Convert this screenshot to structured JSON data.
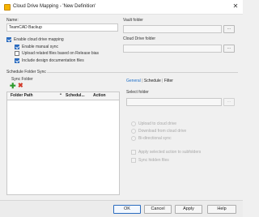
{
  "window": {
    "title": "Cloud Drive Mapping - 'New Definition'",
    "close_glyph": "✕"
  },
  "left": {
    "name_label": "Name:",
    "name_value": "TeamCAD Backup",
    "enable_cloud_mapping": {
      "label": "Enable cloud drive mapping",
      "checked": true
    },
    "enable_manual_sync": {
      "label": "Enable manual sync",
      "checked": true
    },
    "upload_release_bias": {
      "label": "Upload related files based on Release bias",
      "checked": false
    },
    "include_design_docs": {
      "label": "Include design documentation files",
      "checked": true
    }
  },
  "right": {
    "vault_folder_label": "Vault folder",
    "cloud_folder_label": "Cloud Drive folder",
    "browse_label": "..."
  },
  "schedule_sync": {
    "group_label": "Schedule Folder Sync",
    "sync_folder_label": "Sync Folder",
    "add_icon_glyph": "✚",
    "delete_icon_glyph": "✖",
    "columns": [
      "Folder Path",
      "Schedul...",
      "Action"
    ]
  },
  "detail_tabs": {
    "tabs": [
      "General",
      "Schedule",
      "Filter"
    ],
    "separator": "|",
    "active": "General",
    "select_folder_label": "Select folder",
    "browse_label": "...",
    "radios": [
      "Upload to cloud drive",
      "Download from cloud drive",
      "Bi-directional sync"
    ],
    "checkboxes": [
      "Apply selected action to subfolders",
      "Sync hidden files"
    ]
  },
  "footer": {
    "ok": "OK",
    "cancel": "Cancel",
    "apply": "Apply",
    "help": "Help"
  },
  "colors": {
    "accent": "#2a6bbf",
    "tab_active": "#1e6fc8",
    "add_icon": "#2e9b2e",
    "delete_icon": "#d23a2a"
  }
}
